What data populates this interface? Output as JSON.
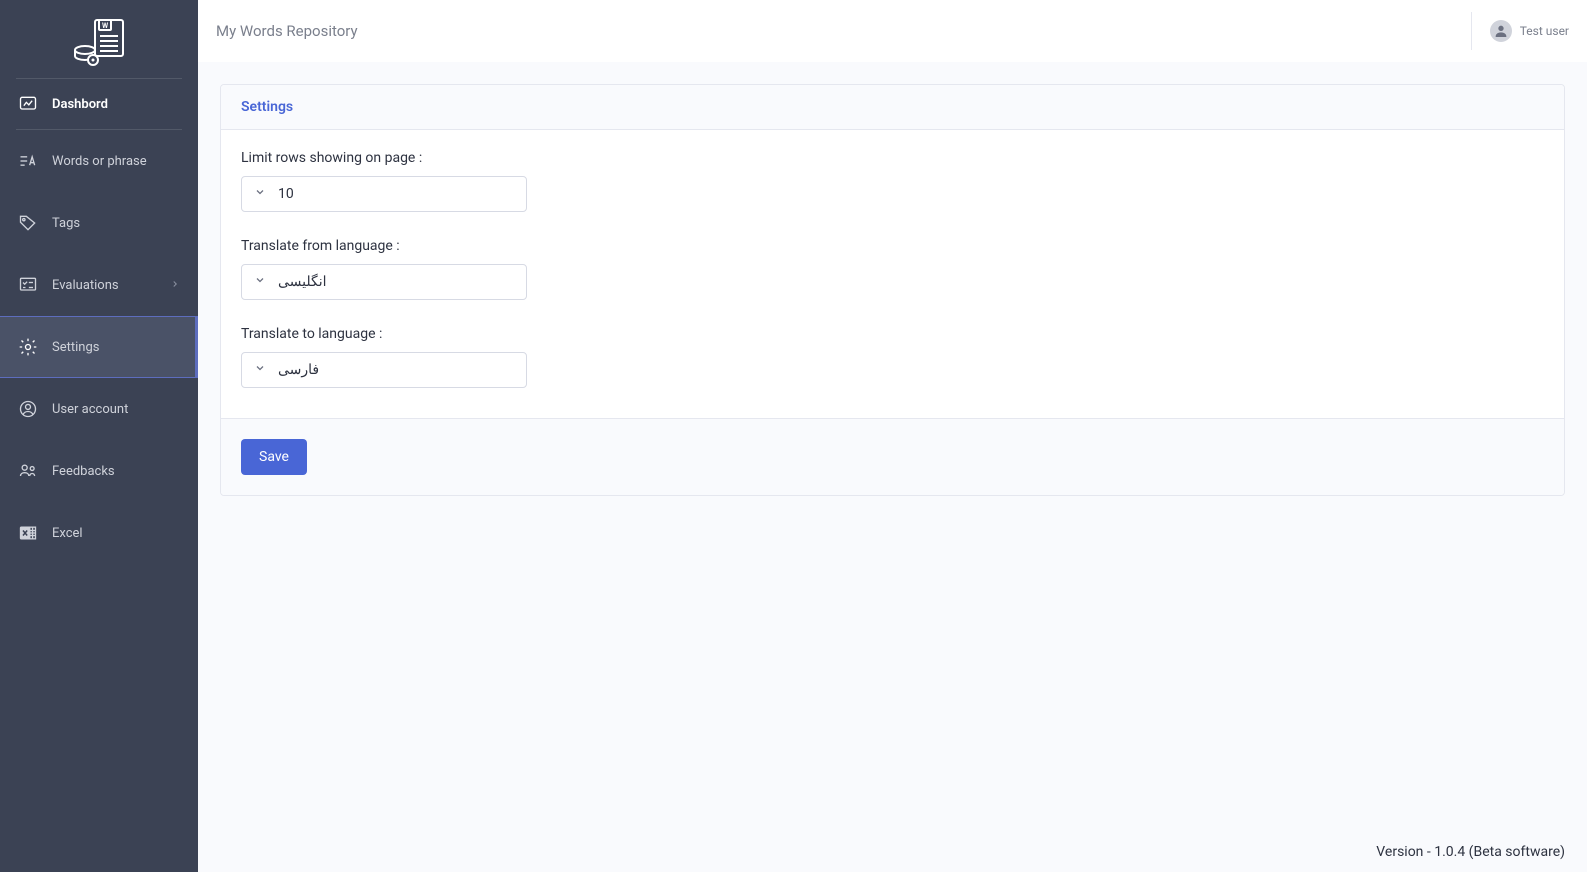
{
  "header": {
    "title": "My Words Repository",
    "user_name": "Test user"
  },
  "sidebar": {
    "items": [
      {
        "label": "Dashbord"
      },
      {
        "label": "Words or phrase"
      },
      {
        "label": "Tags"
      },
      {
        "label": "Evaluations"
      },
      {
        "label": "Settings"
      },
      {
        "label": "User account"
      },
      {
        "label": "Feedbacks"
      },
      {
        "label": "Excel"
      }
    ]
  },
  "settings": {
    "title": "Settings",
    "fields": {
      "limit_label": "Limit rows showing on page :",
      "limit_value": "10",
      "from_label": "Translate from language :",
      "from_value": "انگلیسی",
      "to_label": "Translate to language :",
      "to_value": "فارسی"
    },
    "save_label": "Save"
  },
  "footer": {
    "version_text": "Version - 1.0.4 (Beta software)"
  }
}
